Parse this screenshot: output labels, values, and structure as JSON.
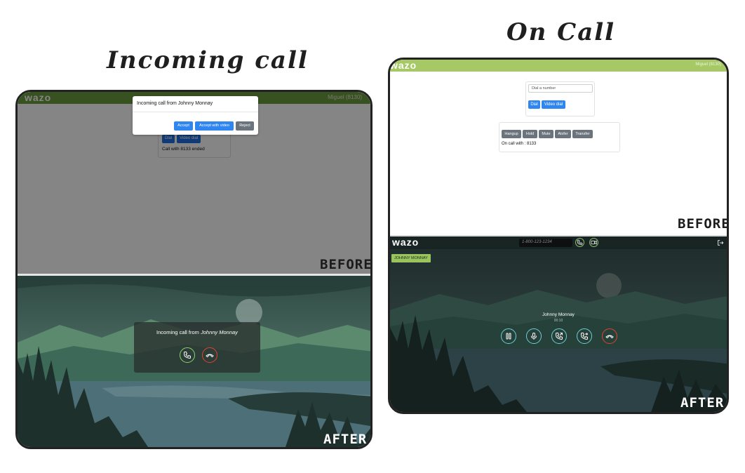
{
  "titles": {
    "incoming": "Incoming call",
    "on_call": "On Call"
  },
  "labels": {
    "before": "BEFORE",
    "after": "AFTER"
  },
  "brand": {
    "logo": "wazo",
    "user_left": "Miguel (8130)",
    "user_right": "Miguel (8130)"
  },
  "incoming_before": {
    "modal_title": "Incoming call from Johnny Monnay",
    "accept": "Accept",
    "accept_video": "Accept with video",
    "reject": "Reject",
    "dial": "Dial",
    "video_dial": "Video dial",
    "status": "Call with 8133 ended"
  },
  "incoming_after": {
    "prefix": "Incoming call from ",
    "caller": "Johnny Monnay"
  },
  "oncall_before": {
    "dial_placeholder": "Dial a number",
    "dial": "Dial",
    "video_dial": "Video dial",
    "buttons": [
      "Hangup",
      "Hold",
      "Mute",
      "Atxfer",
      "Transfer"
    ],
    "status": "On call with : 8133"
  },
  "oncall_after": {
    "search_placeholder": "1-800-123-1234",
    "chip": "JOHNNY MONNAY",
    "caller": "Johnny Monnay",
    "duration": "00:10"
  },
  "colors": {
    "brand_green": "#6c9b3e",
    "brand_green_light": "#a6c865",
    "primary_blue": "#2f86f0",
    "accept_green": "#8cd26a",
    "reject_red": "#e0442f",
    "ctrl_teal": "#6fd0d4"
  }
}
